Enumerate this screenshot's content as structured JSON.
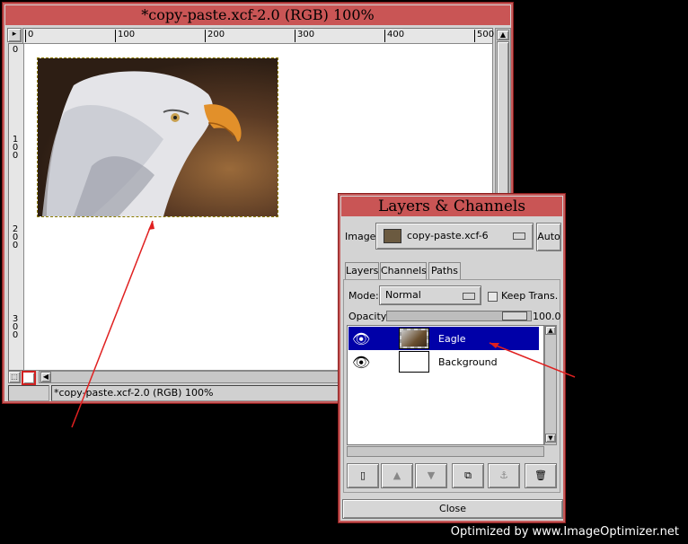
{
  "main_window": {
    "title": "*copy-paste.xcf-2.0 (RGB) 100%",
    "ruler_h_ticks": [
      "0",
      "100",
      "200",
      "300",
      "400",
      "500"
    ],
    "ruler_v_ticks": [
      "0",
      "100",
      "200",
      "300"
    ],
    "status_text": "*copy-paste.xcf-2.0 (RGB) 100%"
  },
  "layers_dialog": {
    "title": "Layers & Channels",
    "image_label": "Image:",
    "image_value": "copy-paste.xcf-6",
    "auto_button": "Auto",
    "tabs": [
      "Layers",
      "Channels",
      "Paths"
    ],
    "mode_label": "Mode:",
    "mode_value": "Normal",
    "keep_trans_label": "Keep Trans.",
    "opacity_label": "Opacity:",
    "opacity_value": "100.0",
    "opacity_fraction": 1.0,
    "layers": [
      {
        "name": "Eagle",
        "selected": true
      },
      {
        "name": "Background",
        "selected": false
      }
    ],
    "close_button": "Close"
  },
  "watermark": "Optimized by www.ImageOptimizer.net",
  "colors": {
    "titlebar": "#c95555",
    "selection": "#0000a8",
    "annotation_arrow": "#e02020"
  }
}
